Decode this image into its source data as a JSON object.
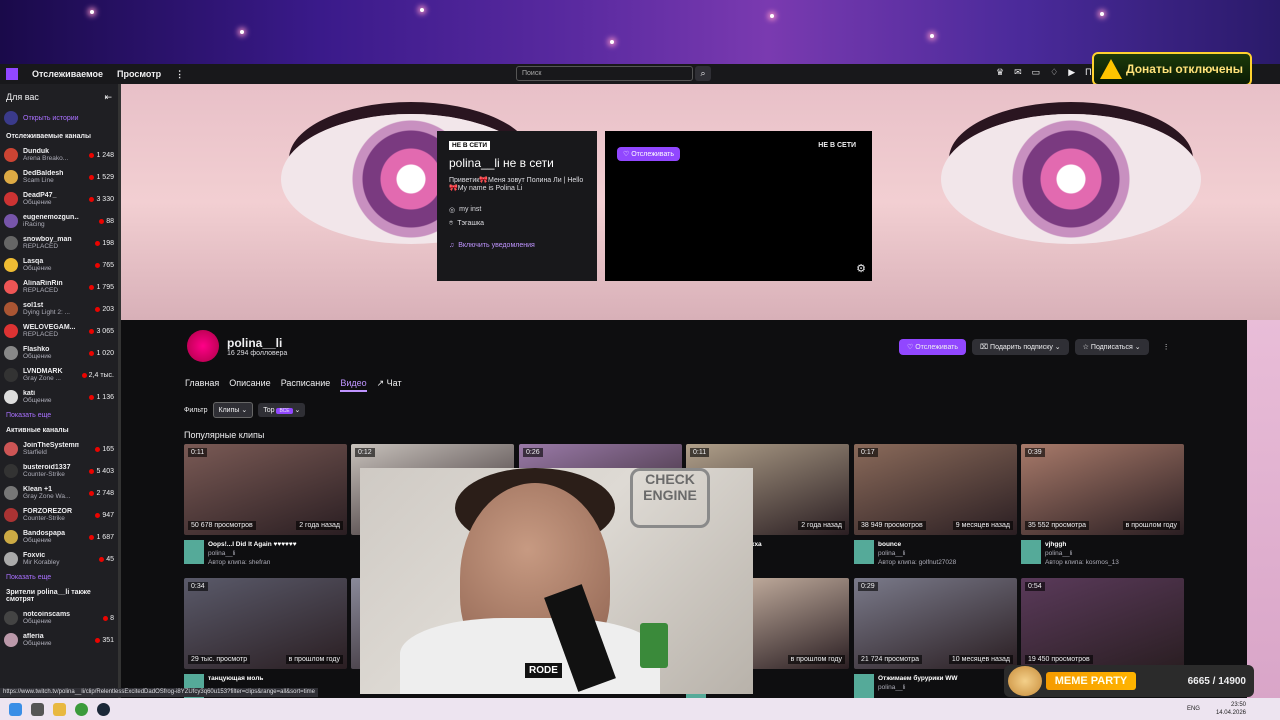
{
  "topnav": {
    "following": "Отслеживаемое",
    "browse": "Просмотр",
    "more": "⋮",
    "search_placeholder": "Поиск",
    "partial": "Под"
  },
  "donate": {
    "text": "Донаты отключены"
  },
  "sidebar": {
    "title": "Для вас",
    "stories": "Открыть истории",
    "followed_title": "Отслеживаемые каналы",
    "followed": [
      {
        "name": "Dunduk",
        "game": "Arena Breako...",
        "viewers": "1 248",
        "color": "#c43"
      },
      {
        "name": "DedBaldesh",
        "game": "Scam Line",
        "viewers": "1 529",
        "color": "#da4"
      },
      {
        "name": "DeadP47_",
        "game": "Общение",
        "viewers": "3 330",
        "color": "#c33"
      },
      {
        "name": "eugenemozgun...",
        "game": "iRacing",
        "viewers": "88",
        "color": "#75a"
      },
      {
        "name": "snowboy_man",
        "game": "REPLACED",
        "viewers": "198",
        "color": "#666"
      },
      {
        "name": "Lasqa",
        "game": "Общение",
        "viewers": "765",
        "color": "#eb3"
      },
      {
        "name": "AlinaRinRin",
        "game": "REPLACED",
        "viewers": "1 795",
        "color": "#e55"
      },
      {
        "name": "sol1st",
        "game": "Dying Light 2: ...",
        "viewers": "203",
        "color": "#a53"
      },
      {
        "name": "WELOVEGAM...",
        "game": "REPLACED",
        "viewers": "3 065",
        "color": "#d33"
      },
      {
        "name": "Flashko",
        "game": "Общение",
        "viewers": "1 020",
        "color": "#888"
      },
      {
        "name": "LVNDMARK",
        "game": "Gray Zone ...",
        "viewers": "2,4 тыс.",
        "color": "#333"
      },
      {
        "name": "kati",
        "game": "Общение",
        "viewers": "1 136",
        "color": "#ddd"
      }
    ],
    "show_more": "Показать еще",
    "active_title": "Активные каналы",
    "active": [
      {
        "name": "JoinTheSystemm",
        "game": "Starfield",
        "viewers": "165",
        "color": "#c55"
      },
      {
        "name": "busteroid1337",
        "game": "Counter-Strike",
        "viewers": "5 403",
        "color": "#333"
      },
      {
        "name": "Klean +1",
        "game": "Gray Zone Wa...",
        "viewers": "2 748",
        "color": "#777"
      },
      {
        "name": "FORZOREZOR",
        "game": "Counter-Strike",
        "viewers": "947",
        "color": "#a33"
      },
      {
        "name": "Bandospapa",
        "game": "Общение",
        "viewers": "1 687",
        "color": "#ca4"
      },
      {
        "name": "Foxvic",
        "game": "Mir Korabley",
        "viewers": "45",
        "color": "#aaa"
      }
    ],
    "show_more2": "Показать еще",
    "viewers_title": "Зрители polina__li также смотрят",
    "viewers_also": [
      {
        "name": "notcoinscams",
        "game": "Общение",
        "viewers": "8",
        "color": "#444"
      },
      {
        "name": "afleria",
        "game": "Общение",
        "viewers": "351",
        "color": "#b9a"
      }
    ]
  },
  "offline": {
    "badge": "НЕ В СЕТИ",
    "title": "polina__li не в сети",
    "desc": "Приветик🎀Меня зовут Полина Ли | Hello🎀My name is Polina Li",
    "inst": "my inst",
    "tag": "Тэгашка",
    "notify": "Включить уведомления"
  },
  "player": {
    "follow": "Отслеживать",
    "status": "НЕ В СЕТИ"
  },
  "channel": {
    "name": "polina__li",
    "followers": "16 294 фолловера",
    "btn_follow": "Отслеживать",
    "btn_gift": "Подарить подписку",
    "btn_sub": "Подписаться"
  },
  "tabs": [
    "Главная",
    "Описание",
    "Расписание",
    "Видео",
    "Чат"
  ],
  "filter": {
    "label": "Фильтр",
    "type": "Клипы",
    "sort": "Top",
    "tag": "ВСЕ"
  },
  "section_title": "Популярные клипы",
  "clips": [
    {
      "dur": "0:11",
      "views": "50 678 просмотров",
      "age": "2 года назад",
      "title": "Oops!...I Did It Again ♥♥♥♥♥♥",
      "channel": "polina__li",
      "author": "Автор клипа: shefran"
    },
    {
      "dur": "0:12",
      "views": "",
      "age": "",
      "title": "",
      "channel": "",
      "author": ""
    },
    {
      "dur": "0:26",
      "views": "",
      "age": "",
      "title": "",
      "channel": "",
      "author": ""
    },
    {
      "dur": "0:11",
      "views": "",
      "age": "2 года назад",
      "title": "а вот так ... ахха",
      "channel": "",
      "author": "р: nikomennn"
    },
    {
      "dur": "0:17",
      "views": "38 949 просмотров",
      "age": "9 месяцев назад",
      "title": "bounce",
      "channel": "polina__li",
      "author": "Автор клипа: golfnut27028"
    },
    {
      "dur": "0:39",
      "views": "35 552 просмотра",
      "age": "в прошлом году",
      "title": "vjhggh",
      "channel": "polina__li",
      "author": "Автор клипа: kosmos_13"
    },
    {
      "dur": "0:34",
      "views": "29 тыс. просмотр",
      "age": "в прошлом году",
      "title": "танцующая моль",
      "channel": "",
      "author": ""
    },
    {
      "dur": "",
      "views": "",
      "age": "",
      "title": "",
      "channel": "",
      "author": ""
    },
    {
      "dur": "",
      "views": "",
      "age": "",
      "title": "",
      "channel": "",
      "author": ""
    },
    {
      "dur": "",
      "views": "в",
      "age": "в прошлом году",
      "title": "бели онлайн",
      "channel": "",
      "author": ""
    },
    {
      "dur": "0:29",
      "views": "21 724 просмотра",
      "age": "10 месяцев назад",
      "title": "Отжимаем бурурики WW",
      "channel": "polina__li",
      "author": ""
    },
    {
      "dur": "0:54",
      "views": "19 450 просмотров",
      "age": "",
      "title": "",
      "channel": "",
      "author": ""
    }
  ],
  "webcam": {
    "sign": "CHECK ENGINE",
    "mic_brand": "RODE"
  },
  "meme": {
    "label": "MEME PARTY",
    "progress": "6665 / 14900"
  },
  "status_url": "https://www.twitch.tv/polina__li/clip/RelentlessExcitedDadOSfrog-i8YZUfcy3q60u153?filter=clips&range=all&sort=time",
  "taskbar": {
    "lang": "ENG",
    "time": "23:50",
    "date": "14.04.2026"
  }
}
